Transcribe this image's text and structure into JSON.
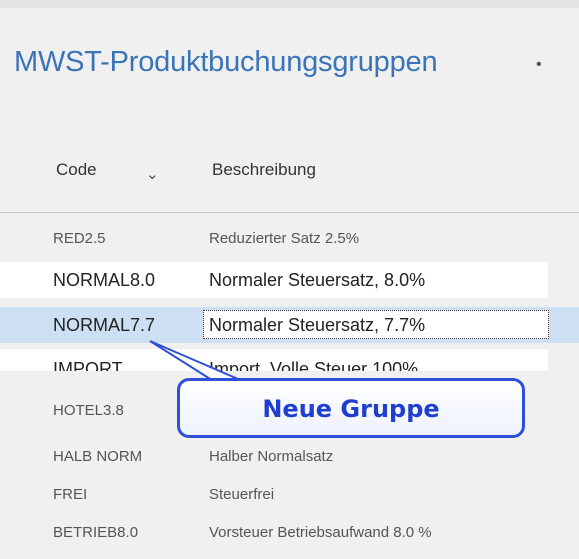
{
  "page_title": "MWST-Produktbuchungsgruppen",
  "columns": {
    "code": "Code",
    "description": "Beschreibung"
  },
  "rows": [
    {
      "code": "RED2.5",
      "description": "Reduzierter Satz 2.5%"
    },
    {
      "code": "NORMAL8.0",
      "description": "Normaler Steuersatz, 8.0%"
    },
    {
      "code": "NORMAL7.7",
      "description": "Normaler Steuersatz, 7.7%"
    },
    {
      "code": "IMPORT",
      "description": "Import, Volle Steuer 100%"
    },
    {
      "code": "HOTEL3.8",
      "description": ""
    },
    {
      "code": "HALB NORM",
      "description": "Halber Normalsatz"
    },
    {
      "code": "FREI",
      "description": "Steuerfrei"
    },
    {
      "code": "BETRIEB8.0",
      "description": "Vorsteuer Betriebsaufwand 8.0 %"
    }
  ],
  "callout": {
    "text": "Neue Gruppe"
  },
  "colors": {
    "title": "#3a74b8",
    "selected_row": "#cde0f3",
    "callout_border": "#2f4fd8"
  },
  "icons": {
    "title_menu": "caret-icon",
    "sort": "sort-down-icon"
  }
}
